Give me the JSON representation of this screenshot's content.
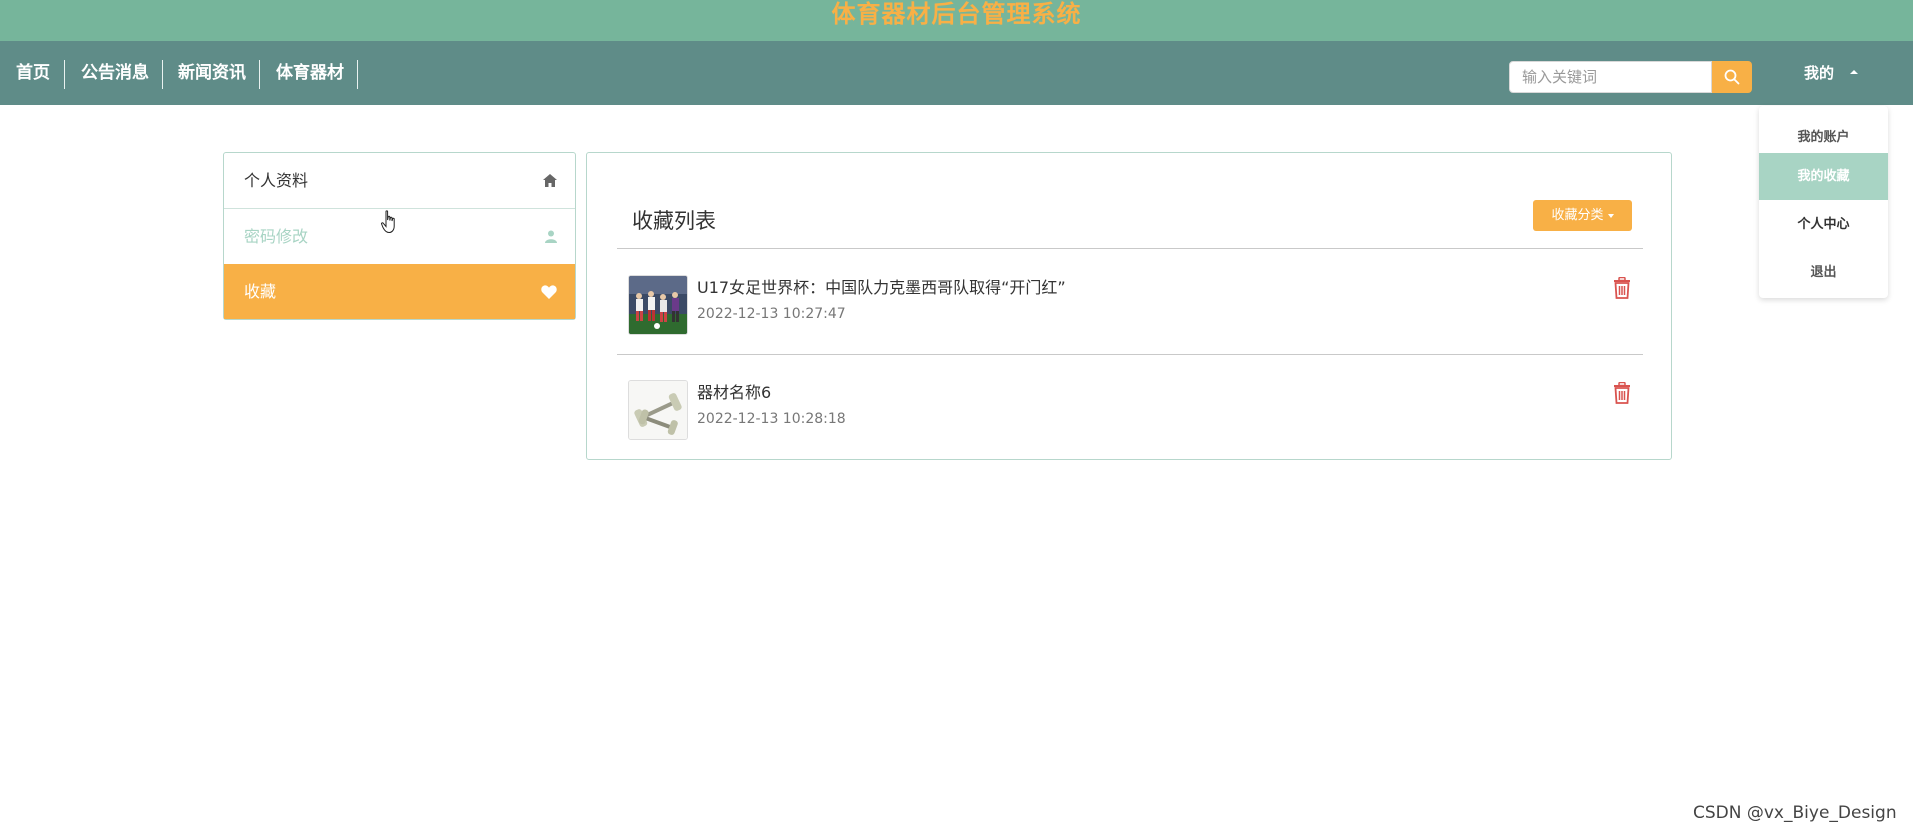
{
  "site": {
    "title": "体育器材后台管理系统"
  },
  "nav": {
    "items": [
      "首页",
      "公告消息",
      "新闻资讯",
      "体育器材"
    ]
  },
  "search": {
    "placeholder": "输入关键词"
  },
  "user_menu": {
    "label": "我的",
    "items": [
      "我的账户",
      "我的收藏",
      "个人中心",
      "退出"
    ]
  },
  "sidebar": {
    "items": [
      {
        "label": "个人资料",
        "icon": "home-icon"
      },
      {
        "label": "密码修改",
        "icon": "user-icon"
      },
      {
        "label": "收藏",
        "icon": "heart-icon"
      }
    ]
  },
  "favorites": {
    "title": "收藏列表",
    "category_button": "收藏分类",
    "items": [
      {
        "title": "U17女足世界杯：中国队力克墨西哥队取得“开门红”",
        "time": "2022-12-13 10:27:47",
        "thumb": "soccer-photo"
      },
      {
        "title": "器材名称6",
        "time": "2022-12-13 10:28:18",
        "thumb": "dumbbell-photo"
      }
    ]
  },
  "watermark": "CSDN @vx_Biye_Design",
  "colors": {
    "topbar": "#76b59b",
    "navbar": "#5f8c88",
    "accent": "#f8b046",
    "light_green": "#a8d4c4",
    "delete_red": "#d9534f"
  }
}
